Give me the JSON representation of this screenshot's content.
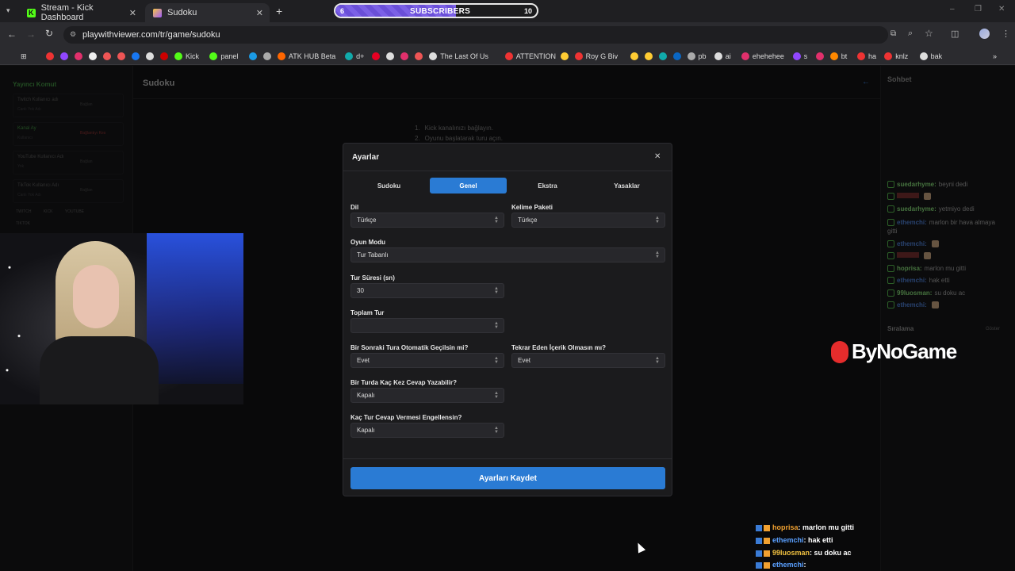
{
  "browser": {
    "tabs": [
      {
        "label": "Stream - Kick Dashboard",
        "icon": "kick-icon"
      },
      {
        "label": "Sudoku",
        "icon": "sudoku-icon"
      }
    ],
    "new_tab": "+",
    "url": "playwithviewer.com/tr/game/sudoku",
    "window_controls": [
      "–",
      "❐",
      "✕"
    ]
  },
  "subscribers_bar": {
    "label": "SUBSCRIBERS",
    "current": "6",
    "goal": "10",
    "progress": 0.6
  },
  "bookmarks": [
    {
      "label": "",
      "color": "#e33"
    },
    {
      "label": "",
      "color": "#9147ff"
    },
    {
      "label": "",
      "color": "#e1306c"
    },
    {
      "label": "",
      "color": "#eee"
    },
    {
      "label": "",
      "color": "#e55"
    },
    {
      "label": "",
      "color": "#e55"
    },
    {
      "label": "",
      "color": "#1877f2"
    },
    {
      "label": "",
      "color": "#ddd"
    },
    {
      "label": "",
      "color": "#c00"
    },
    {
      "label": "Kick",
      "color": "#53fc18"
    },
    {
      "label": "panel",
      "color": "#53fc18"
    },
    {
      "label": "",
      "color": "#1b9ae4"
    },
    {
      "label": "",
      "color": "#aaa"
    },
    {
      "label": "ATK HUB Beta",
      "color": "#f60"
    },
    {
      "label": "d+",
      "color": "#1aa"
    },
    {
      "label": "",
      "color": "#e60023"
    },
    {
      "label": "",
      "color": "#ddd"
    },
    {
      "label": "",
      "color": "#e1306c"
    },
    {
      "label": "",
      "color": "#e55"
    },
    {
      "label": "The Last Of Us",
      "color": "#ddd"
    },
    {
      "label": "ATTENTION",
      "color": "#e33"
    },
    {
      "label": "",
      "color": "#fc3"
    },
    {
      "label": "Roy G Biv",
      "color": "#e33"
    },
    {
      "label": "",
      "color": "#fc3"
    },
    {
      "label": "",
      "color": "#fc3"
    },
    {
      "label": "",
      "color": "#1aa"
    },
    {
      "label": "",
      "color": "#0a66c2"
    },
    {
      "label": "pb",
      "color": "#aaa"
    },
    {
      "label": "ai",
      "color": "#ddd"
    },
    {
      "label": "ehehehee",
      "color": "#e1306c"
    },
    {
      "label": "s",
      "color": "#9147ff"
    },
    {
      "label": "",
      "color": "#e1306c"
    },
    {
      "label": "bt",
      "color": "#f80"
    },
    {
      "label": "ha",
      "color": "#e33"
    },
    {
      "label": "knlz",
      "color": "#e33"
    },
    {
      "label": "bak",
      "color": "#ddd"
    }
  ],
  "left_panel": {
    "title": "Yayıncı Komut",
    "fields": [
      {
        "label": "Twitch Kullanıcı adı",
        "placeholder": "Canlı Yok Adı",
        "button": "Bağlan"
      },
      {
        "label": "Kanal Ay",
        "placeholder": "Kullanıcı",
        "button": "Bağlantıyı Kes"
      },
      {
        "label": "YouTube Kullanıcı Adı",
        "placeholder": "Yok",
        "button": "Bağlan"
      },
      {
        "label": "TikTok Kullanıcı Adı",
        "placeholder": "Canlı Yok Adı",
        "button": "Bağlan"
      }
    ],
    "platforms": [
      "TWITCH",
      "KICK",
      "YOUTUBE",
      "TIKTOK"
    ]
  },
  "page_title": "Sudoku",
  "steps": [
    "Kick kanalınızı bağlayın.",
    "Oyunu başlatarak turu açın."
  ],
  "modal": {
    "title": "Ayarlar",
    "close": "✕",
    "tabs": [
      "Sudoku",
      "Genel",
      "Ekstra",
      "Yasaklar"
    ],
    "active_tab": "Genel",
    "fields": {
      "dil": {
        "label": "Dil",
        "value": "Türkçe"
      },
      "kelime": {
        "label": "Kelime Paketi",
        "value": "Türkçe"
      },
      "mod": {
        "label": "Oyun Modu",
        "value": "Tur Tabanlı"
      },
      "sure": {
        "label": "Tur Süresi (sn)",
        "value": "30"
      },
      "toplam": {
        "label": "Toplam Tur",
        "value": ""
      },
      "otomatik": {
        "label": "Bir Sonraki Tura Otomatik Geçilsin mi?",
        "value": "Evet"
      },
      "tekrar": {
        "label": "Tekrar Eden İçerik Olmasın mı?",
        "value": "Evet"
      },
      "cevap": {
        "label": "Bir Turda Kaç Kez Cevap Yazabilir?",
        "value": "Kapalı"
      },
      "engel": {
        "label": "Kaç Tur Cevap Vermesi Engellensin?",
        "value": "Kapalı"
      }
    },
    "save": "Ayarları Kaydet"
  },
  "chat": {
    "title": "Sohbet",
    "messages": [
      {
        "user": "suedarhyme:",
        "text": "beyni dedi",
        "color": "#7fcf72"
      },
      {
        "user": "",
        "text": "",
        "color": "#c44"
      },
      {
        "user": "suedarhyme:",
        "text": "yetmiyo dedi",
        "color": "#7fcf72"
      },
      {
        "user": "ethemchi:",
        "text": "marlon bir hava almaya gitti",
        "color": "#4a78c8"
      },
      {
        "user": "ethemchi:",
        "text": "",
        "color": "#4a78c8"
      },
      {
        "user": "",
        "text": "",
        "color": "#c44"
      },
      {
        "user": "hoprisa:",
        "text": "marlon mu gitti",
        "color": "#7fcf72"
      },
      {
        "user": "ethemchi:",
        "text": "hak etti",
        "color": "#4a78c8"
      },
      {
        "user": "99luosman:",
        "text": "su doku ac",
        "color": "#7fcf72"
      },
      {
        "user": "ethemchi:",
        "text": "",
        "color": "#4a78c8"
      }
    ],
    "ranking_title": "Sıralama",
    "ranking_action": "Göster"
  },
  "sponsor": "ByNoGame",
  "stream_chat": [
    {
      "user": "hoprisa",
      "text": ": marlon mu gitti",
      "color": "#f0a030"
    },
    {
      "user": "ethemchi",
      "text": ": hak etti",
      "color": "#5aa0ff"
    },
    {
      "user": "99luosman",
      "text": ": su doku ac",
      "color": "#f0c040"
    },
    {
      "user": "ethemchi",
      "text": ": ",
      "color": "#5aa0ff"
    }
  ]
}
